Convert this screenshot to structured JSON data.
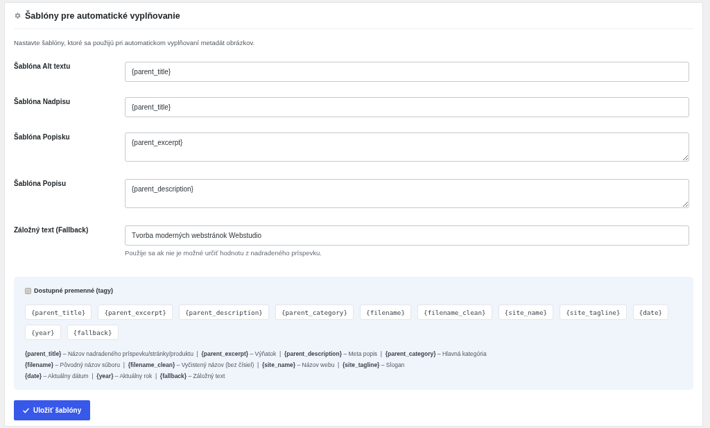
{
  "header": {
    "title": "Šablóny pre automatické vyplňovanie",
    "description": "Nastavte šablóny, ktoré sa použijú pri automatickom vyplňovaní metadát obrázkov."
  },
  "fields": [
    {
      "label": "Šablóna Alt textu",
      "kind": "input",
      "value": "{parent_title}"
    },
    {
      "label": "Šablóna Nadpisu",
      "kind": "input",
      "value": "{parent_title}"
    },
    {
      "label": "Šablóna Popisku",
      "kind": "textarea",
      "value": "{parent_excerpt}"
    },
    {
      "label": "Šablóna Popisu",
      "kind": "textarea",
      "value": "{parent_description}"
    },
    {
      "label": "Záložný text (Fallback)",
      "kind": "input",
      "value": "Tvorba moderných webstránok Webstudio",
      "help": "Použije sa ak nie je možné určiť hodnotu z nadradeného príspevku."
    }
  ],
  "variables": {
    "title": "Dostupné premenné (tagy)",
    "tags": [
      "{parent_title}",
      "{parent_excerpt}",
      "{parent_description}",
      "{parent_category}",
      "{filename}",
      "{filename_clean}",
      "{site_name}",
      "{site_tagline}",
      "{date}",
      "{year}",
      "{fallback}"
    ],
    "legend": [
      "**{parent_title}** – Názov nadradeného príspevku/stránky/produktu  |  **{parent_excerpt}** – Výňatok  |  **{parent_description}** – Meta popis  |  **{parent_category}** – Hlavná kategória",
      "**{filename}** – Pôvodný názov súboru  |  **{filename_clean}** – Vyčistený názov (bez čísiel)  |  **{site_name}** – Názov webu  |  **{site_tagline}** – Slogan",
      "**{date}** – Aktuálny dátum  |  **{year}** – Aktuálny rok  |  **{fallback}** – Záložný text"
    ]
  },
  "save_button": {
    "label": "Uložiť šablóny"
  }
}
